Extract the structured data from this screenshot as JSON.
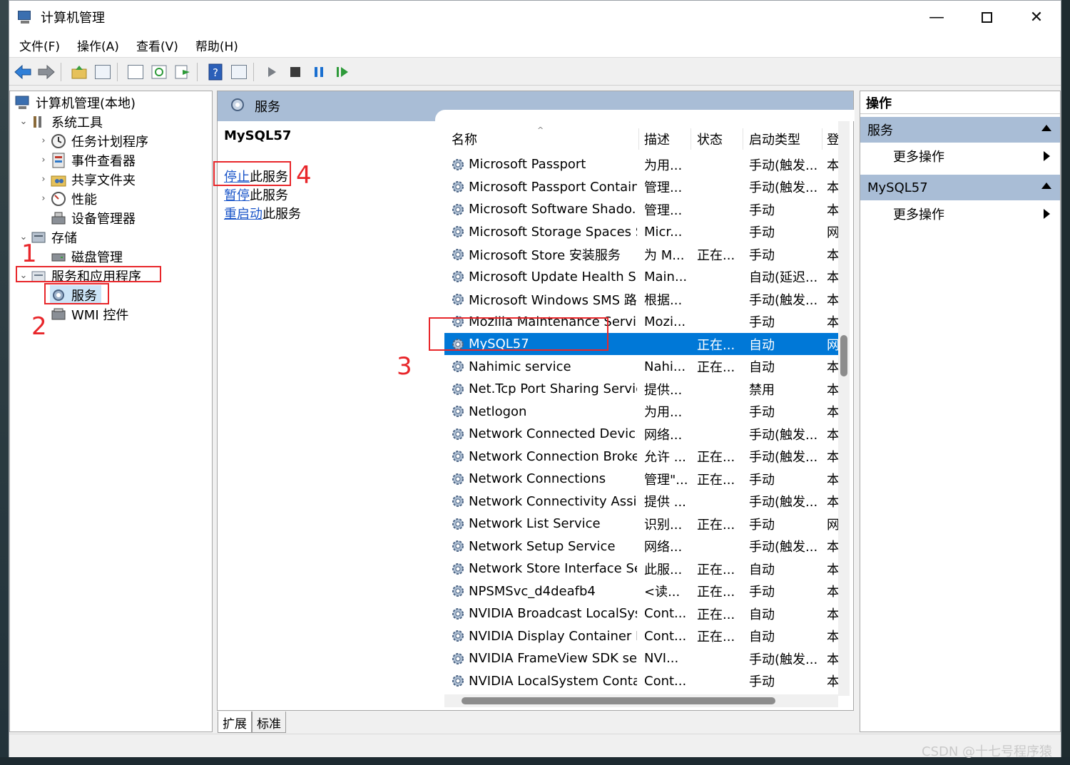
{
  "window": {
    "title": "计算机管理"
  },
  "menu": [
    "文件(F)",
    "操作(A)",
    "查看(V)",
    "帮助(H)"
  ],
  "tree": {
    "root": "计算机管理(本地)",
    "system_tools": "系统工具",
    "task_scheduler": "任务计划程序",
    "event_viewer": "事件查看器",
    "shared_folders": "共享文件夹",
    "performance": "性能",
    "device_manager": "设备管理器",
    "storage": "存储",
    "disk_management": "磁盘管理",
    "services_apps": "服务和应用程序",
    "services": "服务",
    "wmi": "WMI 控件"
  },
  "services_pane": {
    "header": "服务",
    "selected_name": "MySQL57",
    "stop_link": "停止",
    "stop_rest": "此服务",
    "pause_link": "暂停",
    "pause_rest": "此服务",
    "restart_link": "重启动",
    "restart_rest": "此服务",
    "columns": {
      "name": "名称",
      "desc": "描述",
      "status": "状态",
      "startup": "启动类型",
      "logon": "登"
    },
    "rows": [
      {
        "name": "Microsoft Passport",
        "desc": "为用...",
        "status": "",
        "startup": "手动(触发...",
        "logon": "本"
      },
      {
        "name": "Microsoft Passport Container",
        "desc": "管理...",
        "status": "",
        "startup": "手动(触发...",
        "logon": "本"
      },
      {
        "name": "Microsoft Software Shado...",
        "desc": "管理...",
        "status": "",
        "startup": "手动",
        "logon": "本"
      },
      {
        "name": "Microsoft Storage Spaces S...",
        "desc": "Micr...",
        "status": "",
        "startup": "手动",
        "logon": "网"
      },
      {
        "name": "Microsoft Store 安装服务",
        "desc": "为 M...",
        "status": "正在...",
        "startup": "手动",
        "logon": "本"
      },
      {
        "name": "Microsoft Update Health S...",
        "desc": "Main...",
        "status": "",
        "startup": "自动(延迟...",
        "logon": "本"
      },
      {
        "name": "Microsoft Windows SMS 路...",
        "desc": "根据...",
        "status": "",
        "startup": "手动(触发...",
        "logon": "本"
      },
      {
        "name": "Mozilla Maintenance Service",
        "desc": "Mozi...",
        "status": "",
        "startup": "手动",
        "logon": "本"
      },
      {
        "name": "MySQL57",
        "desc": "",
        "status": "正在...",
        "startup": "自动",
        "logon": "网"
      },
      {
        "name": "Nahimic service",
        "desc": "Nahi...",
        "status": "正在...",
        "startup": "自动",
        "logon": "本"
      },
      {
        "name": "Net.Tcp Port Sharing Service",
        "desc": "提供...",
        "status": "",
        "startup": "禁用",
        "logon": "本"
      },
      {
        "name": "Netlogon",
        "desc": "为用...",
        "status": "",
        "startup": "手动",
        "logon": "本"
      },
      {
        "name": "Network Connected Devic...",
        "desc": "网络...",
        "status": "",
        "startup": "手动(触发...",
        "logon": "本"
      },
      {
        "name": "Network Connection Broker",
        "desc": "允许 ...",
        "status": "正在...",
        "startup": "手动(触发...",
        "logon": "本"
      },
      {
        "name": "Network Connections",
        "desc": "管理\"...",
        "status": "正在...",
        "startup": "手动",
        "logon": "本"
      },
      {
        "name": "Network Connectivity Assis...",
        "desc": "提供 ...",
        "status": "",
        "startup": "手动(触发...",
        "logon": "本"
      },
      {
        "name": "Network List Service",
        "desc": "识别...",
        "status": "正在...",
        "startup": "手动",
        "logon": "网"
      },
      {
        "name": "Network Setup Service",
        "desc": "网络...",
        "status": "",
        "startup": "手动(触发...",
        "logon": "本"
      },
      {
        "name": "Network Store Interface Se...",
        "desc": "此服...",
        "status": "正在...",
        "startup": "自动",
        "logon": "本"
      },
      {
        "name": "NPSMSvc_d4deafb4",
        "desc": "<读...",
        "status": "正在...",
        "startup": "手动",
        "logon": "本"
      },
      {
        "name": "NVIDIA Broadcast LocalSys...",
        "desc": "Cont...",
        "status": "正在...",
        "startup": "自动",
        "logon": "本"
      },
      {
        "name": "NVIDIA Display Container LS",
        "desc": "Cont...",
        "status": "正在...",
        "startup": "自动",
        "logon": "本"
      },
      {
        "name": "NVIDIA FrameView SDK se...",
        "desc": "NVI...",
        "status": "",
        "startup": "手动(触发...",
        "logon": "本"
      },
      {
        "name": "NVIDIA LocalSystem Conta...",
        "desc": "Cont...",
        "status": "",
        "startup": "手动",
        "logon": "本"
      }
    ],
    "tabs": [
      "扩展",
      "标准"
    ]
  },
  "actions": {
    "header": "操作",
    "section1": "服务",
    "more1": "更多操作",
    "section2": "MySQL57",
    "more2": "更多操作"
  },
  "annotations": {
    "n1": "1",
    "n2": "2",
    "n3": "3",
    "n4": "4",
    "color": "#e8262a"
  },
  "watermark": "CSDN @十七号程序猿",
  "colors": {
    "selection": "#0078d7",
    "header_blue": "#a9bdd6",
    "link": "#1a55c9"
  }
}
